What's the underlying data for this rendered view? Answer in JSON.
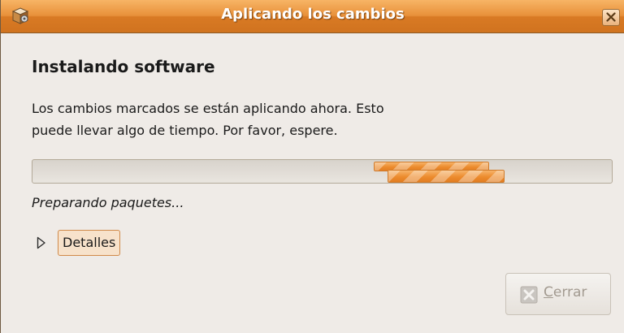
{
  "window": {
    "title": "Aplicando los cambios",
    "app_icon": "package-manager-icon",
    "close_icon": "close-icon"
  },
  "content": {
    "heading": "Instalando software",
    "description_line1": "Los cambios marcados se están aplicando ahora. Esto",
    "description_line2": "puede llevar algo de tiempo. Por favor, espere.",
    "progress_mode": "indeterminate",
    "status": "Preparando paquetes...",
    "details": {
      "label": "Detalles",
      "icon": "expander-arrow-icon",
      "expanded": false
    }
  },
  "buttons": {
    "close": {
      "mnemonic": "C",
      "label_rest": "errar",
      "icon": "close-x-icon",
      "enabled": false
    }
  },
  "colors": {
    "accent": "#e8913a",
    "window_bg": "#efebe7"
  }
}
